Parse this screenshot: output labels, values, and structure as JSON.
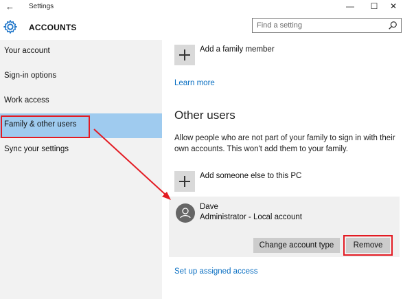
{
  "window": {
    "title": "Settings",
    "back_icon": "back-arrow-icon",
    "minimize_icon": "minimize-icon",
    "maximize_icon": "maximize-icon",
    "close_icon": "close-icon"
  },
  "header": {
    "icon": "gear-icon",
    "title": "ACCOUNTS"
  },
  "search": {
    "placeholder": "Find a setting",
    "icon": "search-icon"
  },
  "sidebar": {
    "items": [
      {
        "label": "Your account"
      },
      {
        "label": "Sign-in options"
      },
      {
        "label": "Work access"
      },
      {
        "label": "Family & other users",
        "active": true
      },
      {
        "label": "Sync your settings"
      }
    ]
  },
  "main": {
    "add_family_member": "Add a family member",
    "learn_more": "Learn more",
    "other_users_heading": "Other users",
    "other_users_desc": "Allow people who are not part of your family to sign in with their own accounts. This won't add them to your family.",
    "add_someone_else": "Add someone else to this PC",
    "user": {
      "name": "Dave",
      "type": "Administrator - Local account",
      "avatar_icon": "person-icon"
    },
    "change_account_type": "Change account type",
    "remove": "Remove",
    "assigned_access": "Set up assigned access"
  },
  "colors": {
    "accent_link": "#0a6fc2",
    "selected_nav": "#9fcbef",
    "annotation_red": "#e31b23"
  }
}
